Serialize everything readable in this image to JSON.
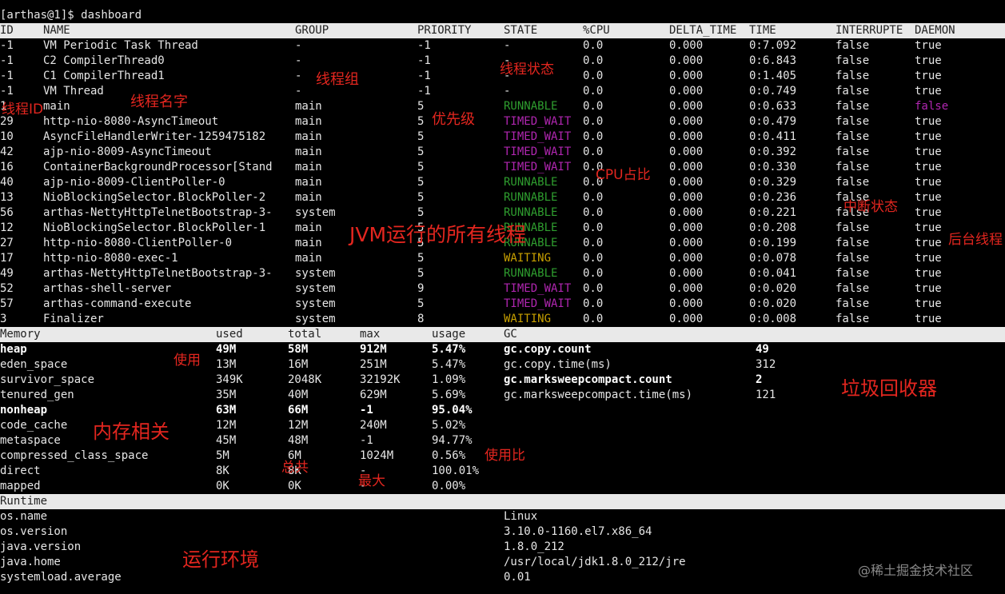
{
  "prompt": "[arthas@1]$ dashboard",
  "threads": {
    "headers": [
      "ID",
      "NAME",
      "GROUP",
      "PRIORITY",
      "STATE",
      "%CPU",
      "DELTA_TIME",
      "TIME",
      "INTERRUPTE",
      "DAEMON"
    ],
    "rows": [
      {
        "id": "-1",
        "name": "VM Periodic Task Thread",
        "group": "-",
        "priority": "-1",
        "state": "-",
        "cpu": "0.0",
        "delta": "0.000",
        "time": "0:7.092",
        "interrupted": "false",
        "daemon": "true"
      },
      {
        "id": "-1",
        "name": "C2 CompilerThread0",
        "group": "-",
        "priority": "-1",
        "state": "-",
        "cpu": "0.0",
        "delta": "0.000",
        "time": "0:6.843",
        "interrupted": "false",
        "daemon": "true"
      },
      {
        "id": "-1",
        "name": "C1 CompilerThread1",
        "group": "-",
        "priority": "-1",
        "state": "-",
        "cpu": "0.0",
        "delta": "0.000",
        "time": "0:1.405",
        "interrupted": "false",
        "daemon": "true"
      },
      {
        "id": "-1",
        "name": "VM Thread",
        "group": "-",
        "priority": "-1",
        "state": "-",
        "cpu": "0.0",
        "delta": "0.000",
        "time": "0:0.749",
        "interrupted": "false",
        "daemon": "true"
      },
      {
        "id": "1",
        "name": "main",
        "group": "main",
        "priority": "5",
        "state": "RUNNABLE",
        "cpu": "0.0",
        "delta": "0.000",
        "time": "0:0.633",
        "interrupted": "false",
        "daemon": "false"
      },
      {
        "id": "29",
        "name": "http-nio-8080-AsyncTimeout",
        "group": "main",
        "priority": "5",
        "state": "TIMED_WAIT",
        "cpu": "0.0",
        "delta": "0.000",
        "time": "0:0.479",
        "interrupted": "false",
        "daemon": "true"
      },
      {
        "id": "10",
        "name": "AsyncFileHandlerWriter-1259475182",
        "group": "main",
        "priority": "5",
        "state": "TIMED_WAIT",
        "cpu": "0.0",
        "delta": "0.000",
        "time": "0:0.411",
        "interrupted": "false",
        "daemon": "true"
      },
      {
        "id": "42",
        "name": "ajp-nio-8009-AsyncTimeout",
        "group": "main",
        "priority": "5",
        "state": "TIMED_WAIT",
        "cpu": "0.0",
        "delta": "0.000",
        "time": "0:0.392",
        "interrupted": "false",
        "daemon": "true"
      },
      {
        "id": "16",
        "name": "ContainerBackgroundProcessor[Stand",
        "group": "main",
        "priority": "5",
        "state": "TIMED_WAIT",
        "cpu": "0.0",
        "delta": "0.000",
        "time": "0:0.330",
        "interrupted": "false",
        "daemon": "true"
      },
      {
        "id": "40",
        "name": "ajp-nio-8009-ClientPoller-0",
        "group": "main",
        "priority": "5",
        "state": "RUNNABLE",
        "cpu": "0.0",
        "delta": "0.000",
        "time": "0:0.329",
        "interrupted": "false",
        "daemon": "true"
      },
      {
        "id": "13",
        "name": "NioBlockingSelector.BlockPoller-2",
        "group": "main",
        "priority": "5",
        "state": "RUNNABLE",
        "cpu": "0.0",
        "delta": "0.000",
        "time": "0:0.236",
        "interrupted": "false",
        "daemon": "true"
      },
      {
        "id": "56",
        "name": "arthas-NettyHttpTelnetBootstrap-3-",
        "group": "system",
        "priority": "5",
        "state": "RUNNABLE",
        "cpu": "0.0",
        "delta": "0.000",
        "time": "0:0.221",
        "interrupted": "false",
        "daemon": "true"
      },
      {
        "id": "12",
        "name": "NioBlockingSelector.BlockPoller-1",
        "group": "main",
        "priority": "5",
        "state": "RUNNABLE",
        "cpu": "0.0",
        "delta": "0.000",
        "time": "0:0.208",
        "interrupted": "false",
        "daemon": "true"
      },
      {
        "id": "27",
        "name": "http-nio-8080-ClientPoller-0",
        "group": "main",
        "priority": "5",
        "state": "RUNNABLE",
        "cpu": "0.0",
        "delta": "0.000",
        "time": "0:0.199",
        "interrupted": "false",
        "daemon": "true"
      },
      {
        "id": "17",
        "name": "http-nio-8080-exec-1",
        "group": "main",
        "priority": "5",
        "state": "WAITING",
        "cpu": "0.0",
        "delta": "0.000",
        "time": "0:0.078",
        "interrupted": "false",
        "daemon": "true"
      },
      {
        "id": "49",
        "name": "arthas-NettyHttpTelnetBootstrap-3-",
        "group": "system",
        "priority": "5",
        "state": "RUNNABLE",
        "cpu": "0.0",
        "delta": "0.000",
        "time": "0:0.041",
        "interrupted": "false",
        "daemon": "true"
      },
      {
        "id": "52",
        "name": "arthas-shell-server",
        "group": "system",
        "priority": "9",
        "state": "TIMED_WAIT",
        "cpu": "0.0",
        "delta": "0.000",
        "time": "0:0.020",
        "interrupted": "false",
        "daemon": "true"
      },
      {
        "id": "57",
        "name": "arthas-command-execute",
        "group": "system",
        "priority": "5",
        "state": "TIMED_WAIT",
        "cpu": "0.0",
        "delta": "0.000",
        "time": "0:0.020",
        "interrupted": "false",
        "daemon": "true"
      },
      {
        "id": "3",
        "name": "Finalizer",
        "group": "system",
        "priority": "8",
        "state": "WAITING",
        "cpu": "0.0",
        "delta": "0.000",
        "time": "0:0.008",
        "interrupted": "false",
        "daemon": "true"
      }
    ]
  },
  "memory": {
    "headers": [
      "Memory",
      "used",
      "total",
      "max",
      "usage",
      "GC"
    ],
    "rows": [
      {
        "name": "heap",
        "used": "49M",
        "total": "58M",
        "max": "912M",
        "usage": "5.47%",
        "bold": true
      },
      {
        "name": "eden_space",
        "used": "13M",
        "total": "16M",
        "max": "251M",
        "usage": "5.47%",
        "bold": false
      },
      {
        "name": "survivor_space",
        "used": "349K",
        "total": "2048K",
        "max": "32192K",
        "usage": "1.09%",
        "bold": false
      },
      {
        "name": "tenured_gen",
        "used": "35M",
        "total": "40M",
        "max": "629M",
        "usage": "5.69%",
        "bold": false
      },
      {
        "name": "nonheap",
        "used": "63M",
        "total": "66M",
        "max": "-1",
        "usage": "95.04%",
        "bold": true
      },
      {
        "name": "code_cache",
        "used": "12M",
        "total": "12M",
        "max": "240M",
        "usage": "5.02%",
        "bold": false
      },
      {
        "name": "metaspace",
        "used": "45M",
        "total": "48M",
        "max": "-1",
        "usage": "94.77%",
        "bold": false
      },
      {
        "name": "compressed_class_space",
        "used": "5M",
        "total": "6M",
        "max": "1024M",
        "usage": "0.56%",
        "bold": false
      },
      {
        "name": "direct",
        "used": "8K",
        "total": "8K",
        "max": "-",
        "usage": "100.01%",
        "bold": false
      },
      {
        "name": "mapped",
        "used": "0K",
        "total": "0K",
        "max": "-",
        "usage": "0.00%",
        "bold": false
      }
    ]
  },
  "gc": [
    {
      "name": "gc.copy.count",
      "value": "49",
      "bold": true
    },
    {
      "name": "gc.copy.time(ms)",
      "value": "312",
      "bold": false
    },
    {
      "name": "gc.marksweepcompact.count",
      "value": "2",
      "bold": true
    },
    {
      "name": "gc.marksweepcompact.time(ms)",
      "value": "121",
      "bold": false
    }
  ],
  "runtime": {
    "header": "Runtime",
    "rows": [
      {
        "key": "os.name",
        "value": "Linux"
      },
      {
        "key": "os.version",
        "value": "3.10.0-1160.el7.x86_64"
      },
      {
        "key": "java.version",
        "value": "1.8.0_212"
      },
      {
        "key": "java.home",
        "value": "/usr/local/jdk1.8.0_212/jre"
      },
      {
        "key": "systemload.average",
        "value": "0.01"
      }
    ]
  },
  "annotations": {
    "thread_id": "线程ID",
    "thread_name": "线程名字",
    "thread_group": "线程组",
    "thread_state": "线程状态",
    "priority": "优先级",
    "cpu_ratio": "CPU占比",
    "interrupt_state": "中断状态",
    "daemon": "后台线程",
    "all_threads": "JVM运行的所有线程",
    "used": "使用",
    "memory_related": "内存相关",
    "total": "总共",
    "max": "最大",
    "usage_ratio": "使用比",
    "gc_collector": "垃圾回收器",
    "runtime_env": "运行环境"
  },
  "watermark": "@稀土掘金技术社区",
  "colors": {
    "RUNNABLE": "#2f9e2f",
    "TIMED_WAIT": "#b026b0",
    "WAITING": "#c8a000",
    "daemon_false": "#b026b0",
    "annotation": "#e3261f"
  }
}
